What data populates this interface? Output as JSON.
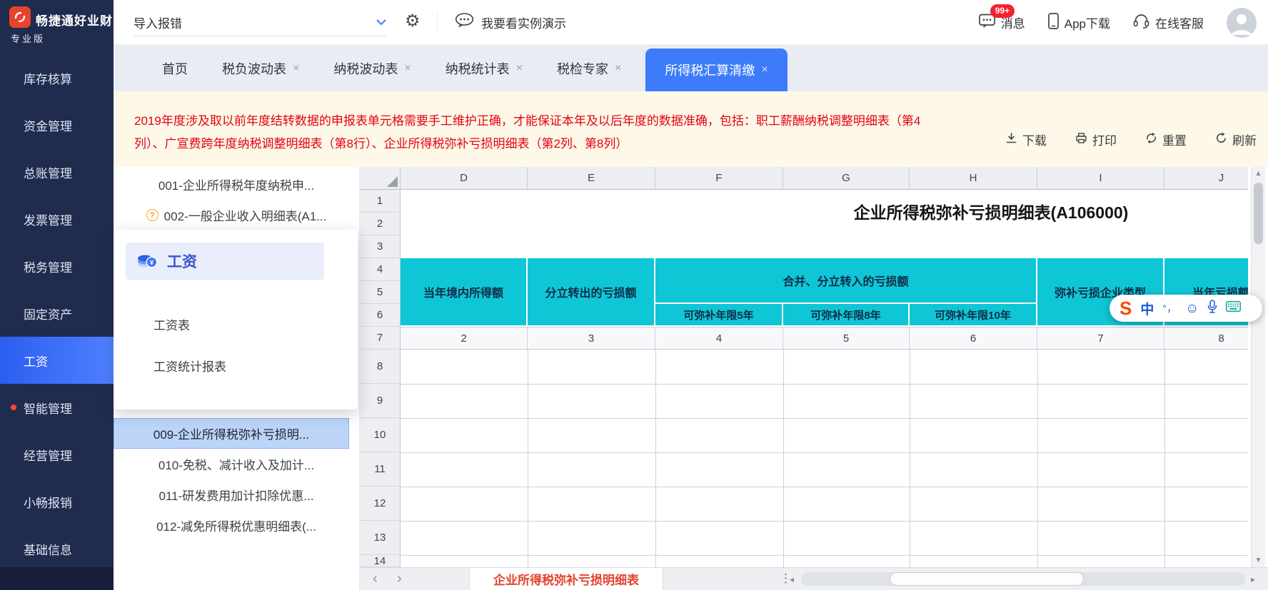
{
  "brand": {
    "name": "畅捷通好业财",
    "edition": "专业版"
  },
  "sidebar": {
    "items": [
      {
        "label": "库存核算"
      },
      {
        "label": "资金管理"
      },
      {
        "label": "总账管理"
      },
      {
        "label": "发票管理"
      },
      {
        "label": "税务管理"
      },
      {
        "label": "固定资产"
      },
      {
        "label": "工资"
      },
      {
        "label": "智能管理"
      },
      {
        "label": "经营管理"
      },
      {
        "label": "小畅报销"
      },
      {
        "label": "基础信息"
      }
    ]
  },
  "topbar": {
    "import_label": "导入报错",
    "demo_label": "我要看实例演示",
    "messages_label": "消息",
    "messages_badge": "99+",
    "app_download_label": "App下载",
    "support_label": "在线客服"
  },
  "tabs": {
    "close": "×",
    "items": [
      {
        "label": "首页"
      },
      {
        "label": "税负波动表"
      },
      {
        "label": "纳税波动表"
      },
      {
        "label": "纳税统计表"
      },
      {
        "label": "税检专家"
      },
      {
        "label": "所得税汇算清缴"
      }
    ]
  },
  "notice": {
    "line1": "2019年度涉及取以前年度结转数据的申报表单元格需要手工维护正确，才能保证本年及以后年度的数据准确，包括：职工薪酬纳税调整明细表（第4",
    "line2": "列）、广宣费跨年度纳税调整明细表（第8行）、企业所得税弥补亏损明细表（第2列、第8列）",
    "download": "下载",
    "print": "打印",
    "reset": "重置",
    "refresh": "刷新"
  },
  "reports": {
    "items": [
      {
        "label": "001-企业所得税年度纳税申..."
      },
      {
        "label": "002-一般企业收入明细表(A1...",
        "help": "?"
      },
      {
        "label": "009-企业所得税弥补亏损明..."
      },
      {
        "label": "010-免税、减计收入及加计..."
      },
      {
        "label": "011-研发费用加计扣除优惠..."
      },
      {
        "label": "012-减免所得税优惠明细表(..."
      }
    ]
  },
  "popup": {
    "title": "工资",
    "items": [
      {
        "label": "工资表"
      },
      {
        "label": "工资统计报表"
      }
    ]
  },
  "sheet": {
    "title": "企业所得税弥补亏损明细表(A106000)",
    "columns": [
      "D",
      "E",
      "F",
      "G",
      "H",
      "I",
      "J"
    ],
    "rows": [
      "1",
      "2",
      "3",
      "4",
      "5",
      "6",
      "7",
      "8",
      "9",
      "10",
      "11",
      "12",
      "13",
      "14"
    ],
    "headers": {
      "d": "当年境内所得额",
      "e": "分立转出的亏损额",
      "fgh": "合并、分立转入的亏损额",
      "f": "可弥补年限5年",
      "g": "可弥补年限8年",
      "h": "可弥补年限10年",
      "i": "弥补亏损企业类型",
      "j": "当年亏损额"
    },
    "index_row": [
      "2",
      "3",
      "4",
      "5",
      "6",
      "7",
      "8"
    ],
    "sheet_tab": "企业所得税弥补亏损明细表"
  },
  "ime": {
    "logo": "S",
    "mode": "中",
    "punct": "°，"
  },
  "colors": {
    "accent_blue": "#3d7bfb",
    "sidebar_navy": "#202c4e",
    "header_teal": "#0fc6d6",
    "warning_red": "#e60012",
    "badge_red": "#f5222d",
    "selected_row_blue": "#bcd4f8",
    "sheet_tab_red": "#e2432e"
  }
}
